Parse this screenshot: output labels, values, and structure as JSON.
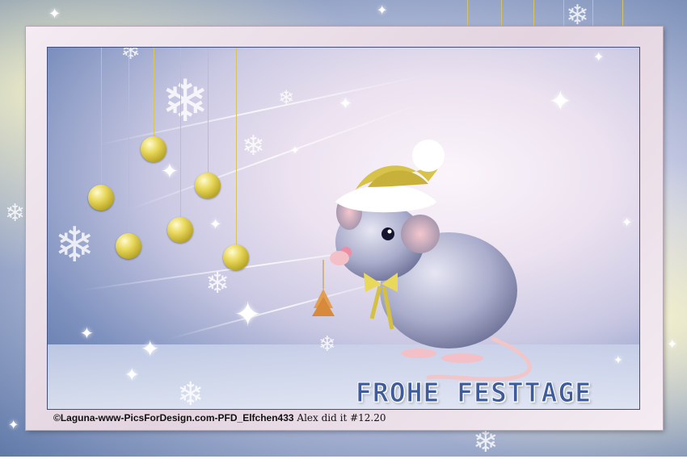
{
  "greeting": "FROHE FESTTAGE",
  "credit": {
    "source": "©Laguna-www-PicsForDesign.com-PFD_Elfchen433",
    "signature": "Alex did it #12.20"
  },
  "colors": {
    "title_blue": "#3e5c9c",
    "ornament_gold": "#e8d85c",
    "frame_pink": "#e3d4e0"
  }
}
